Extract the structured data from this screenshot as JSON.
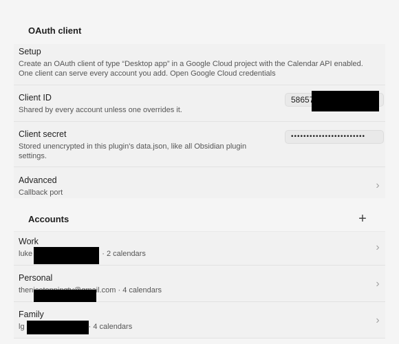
{
  "oauth": {
    "title": "OAuth client",
    "setup": {
      "name": "Setup",
      "desc_line1": "Create an OAuth client of type “Desktop app” in a Google Cloud project with the Calendar API enabled.",
      "desc_line2": "One client can serve every account you add. Open Google Cloud credentials"
    },
    "client_id": {
      "name": "Client ID",
      "desc": "Shared by every account unless one overrides it.",
      "value": "58657"
    },
    "client_secret": {
      "name": "Client secret",
      "desc_line1": "Stored unencrypted in this plugin's data.json, like all Obsidian plugin",
      "desc_line2": "settings.",
      "value": "••••••••••••••••••••••••"
    },
    "advanced": {
      "name": "Advanced",
      "desc": "Callback port"
    }
  },
  "accounts": {
    "title": "Accounts",
    "add_symbol": "+",
    "items": [
      {
        "name": "Work",
        "email_prefix": "luke",
        "calendars": "· 2 calendars"
      },
      {
        "name": "Personal",
        "email_prefix": "thenicetoppingtv@gmail.com",
        "calendars": "· 4 calendars"
      },
      {
        "name": "Family",
        "email_prefix": "lg",
        "calendars": "· 4 calendars"
      }
    ]
  },
  "icons": {
    "chevron": "›"
  },
  "colors": {
    "background": "#f5f5f5",
    "row_background": "#f1f1f1",
    "input_background": "#e9e9e9"
  }
}
